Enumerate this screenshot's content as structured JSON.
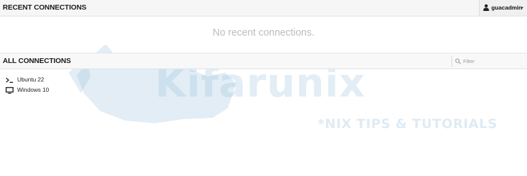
{
  "recent_section": {
    "title": "RECENT CONNECTIONS",
    "empty_message": "No recent connections."
  },
  "user_menu": {
    "icon": "user-icon",
    "username": "guacadmin"
  },
  "all_section": {
    "title": "ALL CONNECTIONS",
    "filter": {
      "placeholder": "Filter",
      "value": ""
    },
    "connections": [
      {
        "label": "Ubuntu 22",
        "icon": "terminal-icon"
      },
      {
        "label": "Windows 10",
        "icon": "monitor-icon"
      }
    ]
  },
  "watermark": {
    "brand": "Kifarunix",
    "tagline": "*NIX TIPS & TUTORIALS"
  },
  "colors": {
    "header_bg": "#f6f6f6",
    "empty_text": "#bcbcbc",
    "watermark": "#96bedc"
  }
}
